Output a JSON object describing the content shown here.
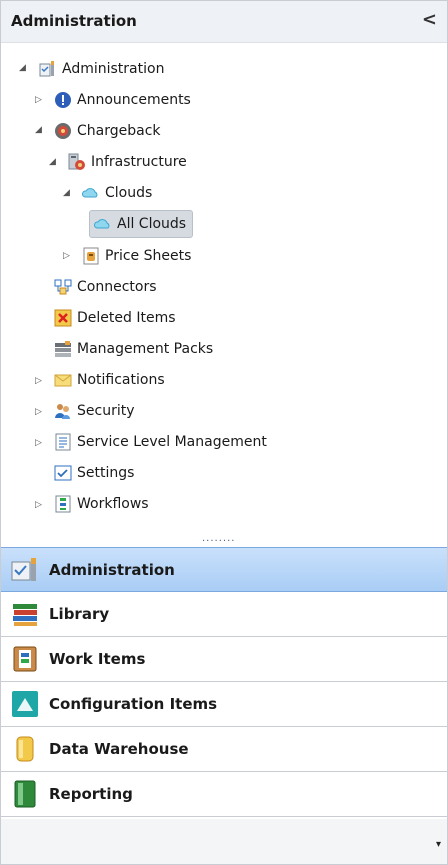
{
  "header": {
    "title": "Administration",
    "collapse_glyph": "<"
  },
  "tree": {
    "root": "Administration",
    "announcements": "Announcements",
    "chargeback": "Chargeback",
    "infrastructure": "Infrastructure",
    "clouds": "Clouds",
    "all_clouds": "All Clouds",
    "price_sheets": "Price Sheets",
    "connectors": "Connectors",
    "deleted_items": "Deleted Items",
    "management_packs": "Management Packs",
    "notifications": "Notifications",
    "security": "Security",
    "service_level_management": "Service Level Management",
    "settings": "Settings",
    "workflows": "Workflows"
  },
  "splitter": "........",
  "nav": {
    "administration": "Administration",
    "library": "Library",
    "work_items": "Work Items",
    "configuration_items": "Configuration Items",
    "data_warehouse": "Data Warehouse",
    "reporting": "Reporting"
  },
  "footer": {
    "dropdown_glyph": "▾"
  },
  "colors": {
    "active_nav": "#b8d6f8",
    "selected_row": "#d6dbe1"
  }
}
